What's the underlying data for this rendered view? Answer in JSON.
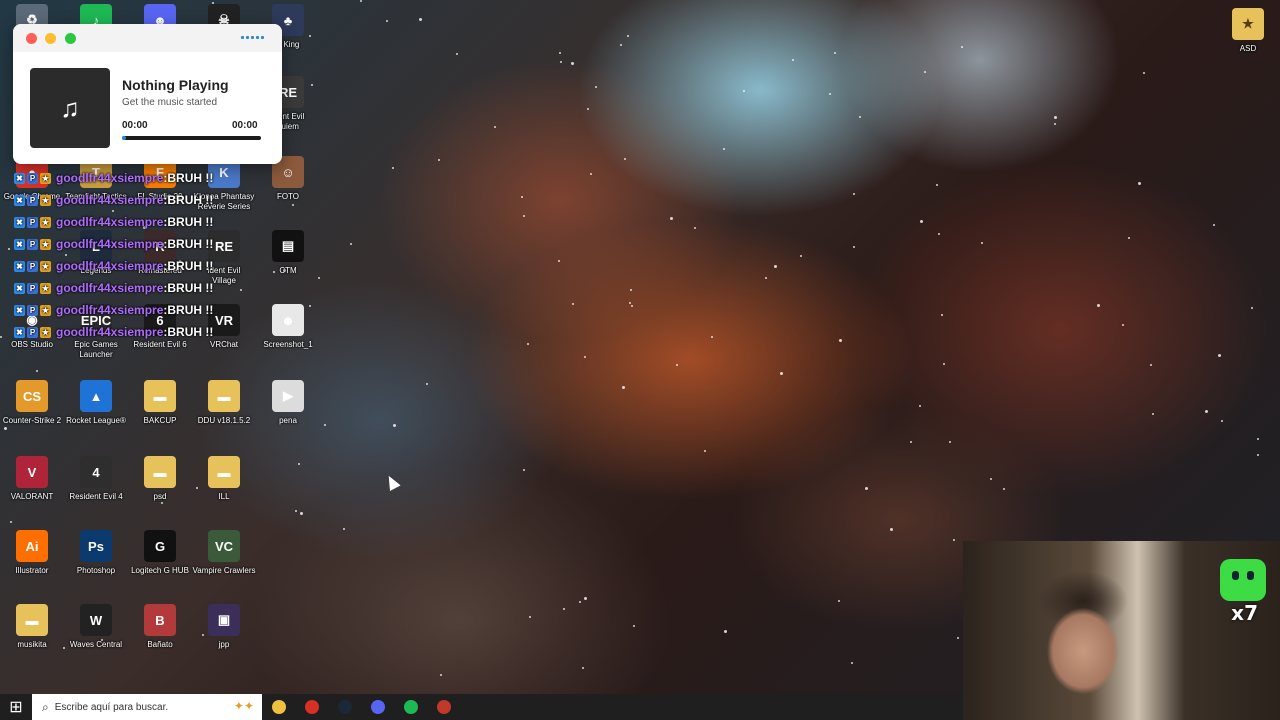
{
  "desktop": {
    "top_right_icon": {
      "label": "ASD",
      "glyph": "★"
    },
    "icons": [
      {
        "label": "",
        "glyph": "♻",
        "color": "#5b6a78"
      },
      {
        "label": "",
        "glyph": "♪",
        "color": "#1db954"
      },
      {
        "label": "",
        "glyph": "☻",
        "color": "#5865f2"
      },
      {
        "label": "",
        "glyph": "☠",
        "color": "#222222"
      },
      {
        "label": "p King",
        "glyph": "♣",
        "color": "#2d3a5a"
      },
      {
        "label": "ident Evil\nquiem",
        "glyph": "RE",
        "color": "#3a3a3a"
      },
      {
        "label": "Google Chrome",
        "glyph": "●",
        "color": "#d93025"
      },
      {
        "label": "Teamfight Tactics",
        "glyph": "T",
        "color": "#c89b3c"
      },
      {
        "label": "FL Studio 20",
        "glyph": "F",
        "color": "#f57c00"
      },
      {
        "label": "Klonoa Phantasy\nReverie Series",
        "glyph": "K",
        "color": "#4a79c9"
      },
      {
        "label": "FOTO",
        "glyph": "☺",
        "color": "#8c5a3c"
      },
      {
        "label": "Legends",
        "glyph": "L",
        "color": "#1e2b3c"
      },
      {
        "label": "Remastered",
        "glyph": "R",
        "color": "#3c2a2a"
      },
      {
        "label": "ident Evil\nVillage",
        "glyph": "RE",
        "color": "#2c2c2c"
      },
      {
        "label": "CTM",
        "glyph": "▤",
        "color": "#111111"
      },
      {
        "label": "OBS Studio",
        "glyph": "◉",
        "color": "#303030"
      },
      {
        "label": "Epic Games\nLauncher",
        "glyph": "EPIC",
        "color": "#2a2a2a"
      },
      {
        "label": "Resident Evil 6",
        "glyph": "6",
        "color": "#1a1a1a"
      },
      {
        "label": "VRChat",
        "glyph": "VR",
        "color": "#1a1a1a"
      },
      {
        "label": "Screenshot_1",
        "glyph": "☻",
        "color": "#e8e8e8"
      },
      {
        "label": "Counter-Strike 2",
        "glyph": "CS",
        "color": "#e39a2a"
      },
      {
        "label": "Rocket League®",
        "glyph": "▲",
        "color": "#1f72d6"
      },
      {
        "label": "BAKCUP",
        "glyph": "▬",
        "color": "#e7c25b"
      },
      {
        "label": "DDU v18.1.5.2",
        "glyph": "▬",
        "color": "#e7c25b"
      },
      {
        "label": "pena",
        "glyph": "▶",
        "color": "#dcdcdc"
      },
      {
        "label": "VALORANT",
        "glyph": "V",
        "color": "#b0243a"
      },
      {
        "label": "Resident Evil 4",
        "glyph": "4",
        "color": "#2e2e2e"
      },
      {
        "label": "psd",
        "glyph": "▬",
        "color": "#e7c25b"
      },
      {
        "label": "ILL",
        "glyph": "▬",
        "color": "#e7c25b"
      },
      {
        "label": "Illustrator",
        "glyph": "Ai",
        "color": "#ff6f00"
      },
      {
        "label": "Photoshop",
        "glyph": "Ps",
        "color": "#0a3a6e"
      },
      {
        "label": "Logitech G HUB",
        "glyph": "G",
        "color": "#111111"
      },
      {
        "label": "Vampire Crawlers",
        "glyph": "VC",
        "color": "#3a5a3a"
      },
      {
        "label": "musikita",
        "glyph": "▬",
        "color": "#e7c25b"
      },
      {
        "label": "Waves Central",
        "glyph": "W",
        "color": "#222222"
      },
      {
        "label": "Bañato",
        "glyph": "B",
        "color": "#b33a3a"
      },
      {
        "label": "jpp",
        "glyph": "▣",
        "color": "#3b2f5a"
      }
    ]
  },
  "player": {
    "title": "Nothing Playing",
    "subtitle": "Get the music started",
    "time_current": "00:00",
    "time_total": "00:00",
    "art_glyph": "♫",
    "progress": 0.03,
    "colors": {
      "close": "#ff5f57",
      "minimize": "#febc2e",
      "maximize": "#28c840",
      "accent": "#2a8ad6"
    }
  },
  "chat": {
    "username": "goodlfr44xsiempre",
    "separator": " : ",
    "messages": [
      "BRUH !!",
      "BRUH !!",
      "BRUH !!",
      "BRUH !!",
      "BRUH !!",
      "BRUH !!",
      "BRUH !!",
      "BRUH !!"
    ],
    "badges": [
      {
        "label": "✖",
        "color": "#2d8cf0"
      },
      {
        "label": "P",
        "color": "#3a6fd6"
      },
      {
        "label": "★",
        "color": "#e0a020"
      }
    ]
  },
  "webcam": {
    "overlay_text": "x7"
  },
  "taskbar": {
    "start_glyph": "⊞",
    "search_glyph": "⌕",
    "search_placeholder": "Escribe aquí para buscar.",
    "search_deco": "✦✦",
    "apps": [
      {
        "name": "file-explorer",
        "color": "#f0c040"
      },
      {
        "name": "chrome",
        "color": "#d93025"
      },
      {
        "name": "steam",
        "color": "#1b2838"
      },
      {
        "name": "discord",
        "color": "#5865f2"
      },
      {
        "name": "spotify",
        "color": "#1db954"
      },
      {
        "name": "gear-app",
        "color": "#c0392b"
      }
    ]
  }
}
